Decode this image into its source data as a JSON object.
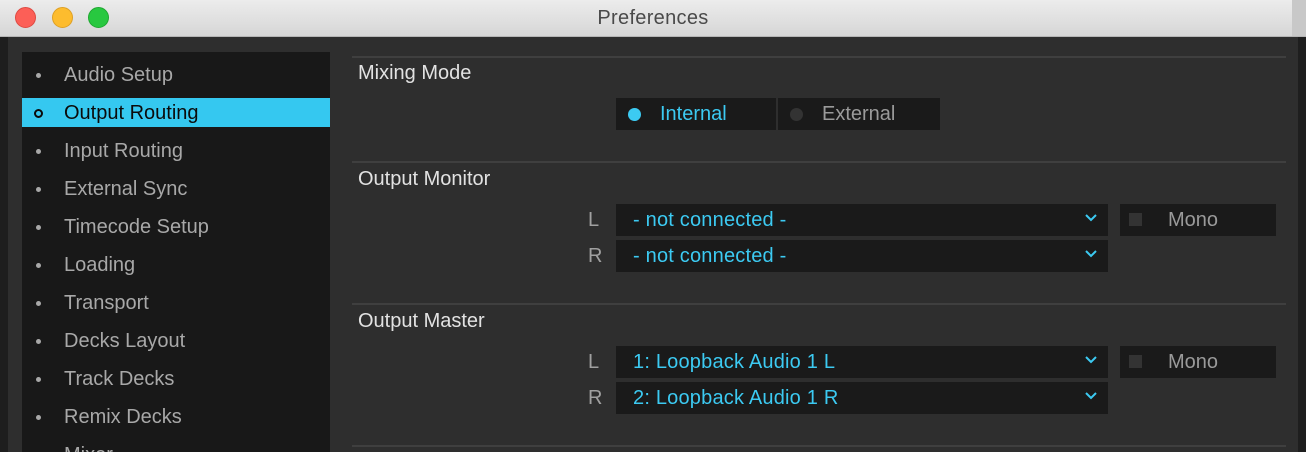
{
  "window": {
    "title": "Preferences"
  },
  "sidebar": {
    "items": [
      {
        "label": "Audio Setup"
      },
      {
        "label": "Output Routing",
        "selected": true
      },
      {
        "label": "Input Routing"
      },
      {
        "label": "External Sync"
      },
      {
        "label": "Timecode Setup"
      },
      {
        "label": "Loading"
      },
      {
        "label": "Transport"
      },
      {
        "label": "Decks Layout"
      },
      {
        "label": "Track Decks"
      },
      {
        "label": "Remix Decks"
      },
      {
        "label": "Mixer"
      }
    ]
  },
  "mixing_mode": {
    "title": "Mixing Mode",
    "options": [
      "Internal",
      "External"
    ],
    "selected": "Internal"
  },
  "output_monitor": {
    "title": "Output Monitor",
    "left_label": "L",
    "right_label": "R",
    "left_value": "- not connected -",
    "right_value": "- not connected -",
    "mono_label": "Mono",
    "mono_checked": false
  },
  "output_master": {
    "title": "Output Master",
    "left_label": "L",
    "right_label": "R",
    "left_value": "1: Loopback Audio 1 L",
    "right_value": "2: Loopback Audio 1 R",
    "mono_label": "Mono",
    "mono_checked": false
  },
  "colors": {
    "accent": "#3ccaf2",
    "selection": "#35c8f0",
    "panel_bg": "#2e2e2e",
    "sidebar_bg": "#181818"
  }
}
